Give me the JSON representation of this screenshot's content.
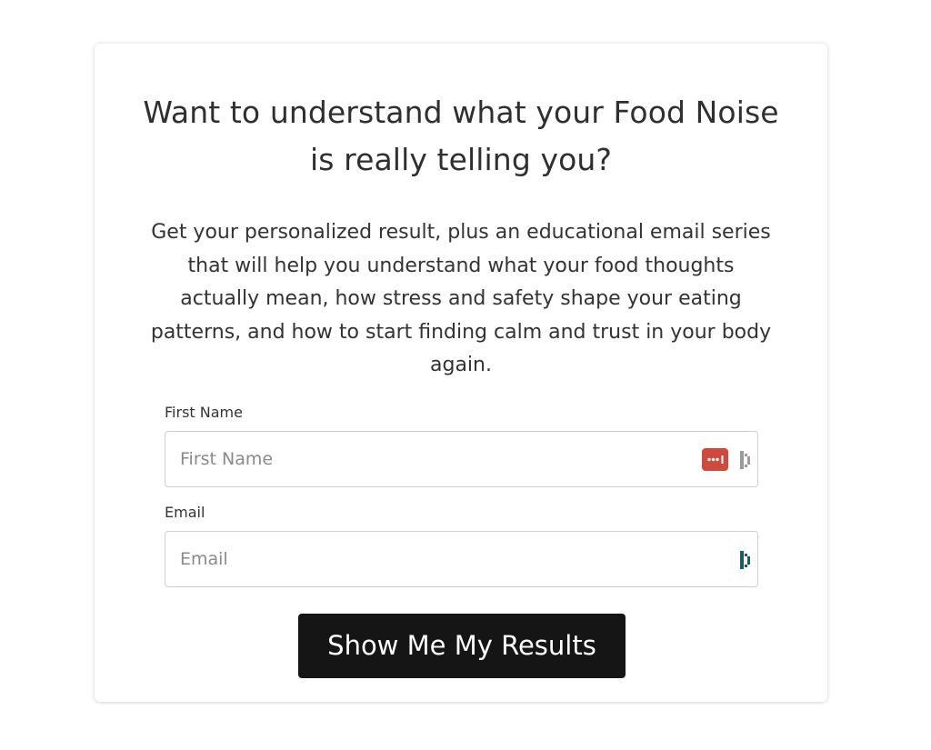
{
  "form": {
    "title_lines": [
      "Want to understand what your Food Noise",
      "is really telling you?"
    ],
    "description_lines": [
      "Get your personalized result, plus an educational email series",
      "that will help you understand what your food thoughts",
      "actually mean, how stress and safety shape your eating",
      "patterns, and how to start finding calm and trust in your body",
      "again."
    ],
    "first_name": {
      "label": "First Name",
      "placeholder": "First Name",
      "value": ""
    },
    "email": {
      "label": "Email",
      "placeholder": "Email",
      "value": ""
    },
    "submit_label": "Show Me My Results"
  },
  "icons": {
    "password_manager": "password-manager-icon",
    "autofill": "dashlane-autofill-icon"
  },
  "colors": {
    "button_bg": "#151515",
    "button_text": "#ffffff",
    "password_icon_bg": "#cf4a3c",
    "autofill_icon_gray": "#9a9a9a",
    "autofill_icon_teal": "#1d5b6b"
  }
}
